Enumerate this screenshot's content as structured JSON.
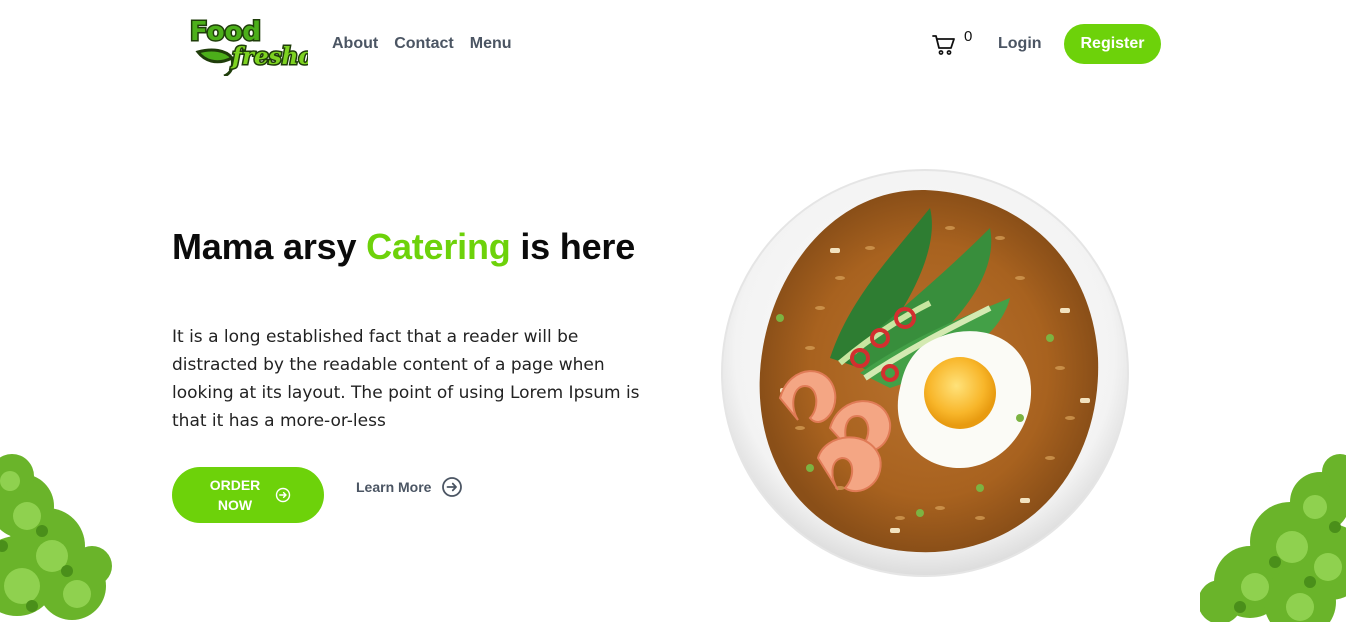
{
  "brand": {
    "logo_word_1": "Food",
    "logo_word_2": "fresho",
    "accent_color": "#6dd20a"
  },
  "nav": {
    "links": [
      "About",
      "Contact",
      "Menu"
    ],
    "cart_icon": "shopping-cart-icon",
    "cart_count": "0",
    "login_label": "Login",
    "register_label": "Register"
  },
  "hero": {
    "title_part_1": "Mama arsy",
    "title_accent": "Catering",
    "title_part_2": "is here",
    "description": "It is a long established fact that a reader will be distracted by the readable content of a page when looking at its layout. The point of using Lorem Ipsum is that it has a more-or-less",
    "order_label": "ORDER NOW",
    "order_icon": "arrow-circle-right-icon",
    "learn_more_label": "Learn More",
    "learn_more_icon": "arrow-circle-right-icon"
  },
  "images": {
    "plate": "fried-rice-plate-image",
    "lettuce": "lettuce-image"
  }
}
